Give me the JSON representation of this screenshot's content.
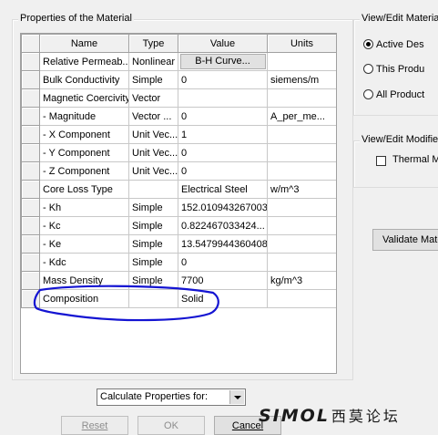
{
  "properties_group": {
    "title": "Properties of the Material",
    "columns": [
      "Name",
      "Type",
      "Value",
      "Units"
    ],
    "rows": [
      {
        "name": "Relative Permeab...",
        "type": "Nonlinear",
        "value": "B-H Curve...",
        "units": "",
        "value_is_button": true
      },
      {
        "name": "Bulk Conductivity",
        "type": "Simple",
        "value": "0",
        "units": "siemens/m"
      },
      {
        "name": "Magnetic Coercivity",
        "type": "Vector",
        "value": "",
        "units": ""
      },
      {
        "name": "- Magnitude",
        "type": "Vector ...",
        "value": "0",
        "units": "A_per_me..."
      },
      {
        "name": "- X Component",
        "type": "Unit Vec...",
        "value": "1",
        "units": ""
      },
      {
        "name": "- Y Component",
        "type": "Unit Vec...",
        "value": "0",
        "units": ""
      },
      {
        "name": "- Z Component",
        "type": "Unit Vec...",
        "value": "0",
        "units": ""
      },
      {
        "name": "Core Loss Type",
        "type": "",
        "value": "Electrical Steel",
        "units": "w/m^3"
      },
      {
        "name": "- Kh",
        "type": "Simple",
        "value": "152.010943267003",
        "units": ""
      },
      {
        "name": "- Kc",
        "type": "Simple",
        "value": "0.822467033424...",
        "units": ""
      },
      {
        "name": "- Ke",
        "type": "Simple",
        "value": "13.5479944360408",
        "units": ""
      },
      {
        "name": "- Kdc",
        "type": "Simple",
        "value": "0",
        "units": ""
      },
      {
        "name": "Mass Density",
        "type": "Simple",
        "value": "7700",
        "units": "kg/m^3"
      },
      {
        "name": "Composition",
        "type": "",
        "value": "Solid",
        "units": ""
      }
    ]
  },
  "view_group": {
    "title": "View/Edit Materia",
    "options": [
      {
        "label": "Active Des",
        "selected": true
      },
      {
        "label": "This Produ",
        "selected": false
      },
      {
        "label": "All Product",
        "selected": false
      }
    ]
  },
  "modifier_group": {
    "title": "View/Edit Modifie",
    "checkbox_label": "Thermal M",
    "checked": false
  },
  "validate_button": "Validate Mate",
  "calculate_select": {
    "value": "Calculate Properties for:"
  },
  "buttons": {
    "reset": "Reset",
    "ok": "OK",
    "cancel": "Cancel"
  },
  "watermark": {
    "latin": "SIMOL",
    "cjk": "西莫论坛"
  },
  "colors": {
    "annotation": "#1414d2",
    "window_bg": "#f0f0f0",
    "grid_line": "#c8c8c8"
  }
}
